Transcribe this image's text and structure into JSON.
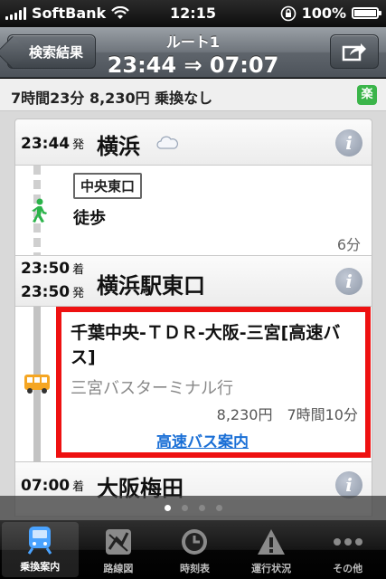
{
  "status": {
    "carrier": "SoftBank",
    "time": "12:15",
    "battery": "100%"
  },
  "nav": {
    "back_label": "検索結果",
    "title": "ルート1",
    "subtitle": "23:44 ⇒ 07:07"
  },
  "summary": {
    "text": "7時間23分 8,230円 乗換なし",
    "badge": "楽"
  },
  "route": {
    "s1": {
      "time": "23:44",
      "suffix": "発",
      "name": "横浜",
      "info": "i"
    },
    "walk": {
      "platform": "中央東口",
      "label": "徒歩",
      "minutes": "6分"
    },
    "s2": {
      "time_arr": "23:50",
      "suffix_arr": "着",
      "time_dep": "23:50",
      "suffix_dep": "発",
      "name": "横浜駅東口",
      "info": "i"
    },
    "bus": {
      "name": "千葉中央-ＴＤＲ-大阪-三宮[高速バス]",
      "dest": "三宮バスターミナル行",
      "fare": "8,230円　7時間10分",
      "link": "高速バス案内"
    },
    "s3": {
      "time": "07:00",
      "suffix": "着",
      "name": "大阪梅田",
      "info": "i"
    }
  },
  "tabs": [
    {
      "label": "乗換案内",
      "icon": "train-icon"
    },
    {
      "label": "路線図",
      "icon": "map-icon"
    },
    {
      "label": "時刻表",
      "icon": "clock-icon"
    },
    {
      "label": "運行状況",
      "icon": "warning-icon"
    },
    {
      "label": "その他",
      "icon": "more-icon"
    }
  ],
  "colors": {
    "highlight": "#ee1111",
    "link": "#1a6fd6",
    "walk": "#2bb34a",
    "bus": "#f5a623",
    "train": "#4aa3ff"
  }
}
